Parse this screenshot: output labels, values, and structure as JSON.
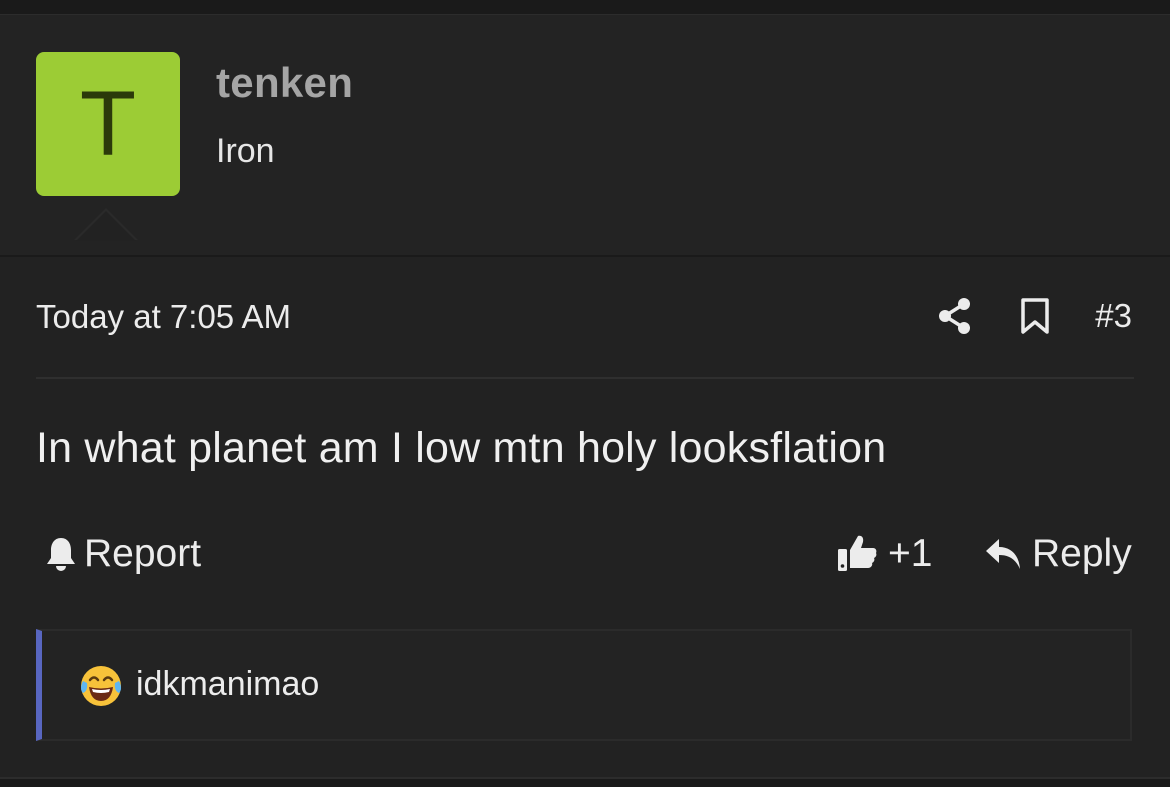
{
  "author": {
    "avatar_letter": "T",
    "avatar_color": "#9ccc35",
    "username": "tenken",
    "title": "Iron"
  },
  "post": {
    "timestamp": "Today at 7:05 AM",
    "number": "#3",
    "message": "In what planet am I low mtn holy looksflation"
  },
  "actions": {
    "share_icon": "share-icon",
    "bookmark_icon": "bookmark-icon",
    "report_label": "Report",
    "like_count": "+1",
    "reply_label": "Reply"
  },
  "reactions": {
    "emoji": "face-with-tears-of-joy",
    "users": "idkmanimao",
    "accent_color": "#5866c0"
  }
}
